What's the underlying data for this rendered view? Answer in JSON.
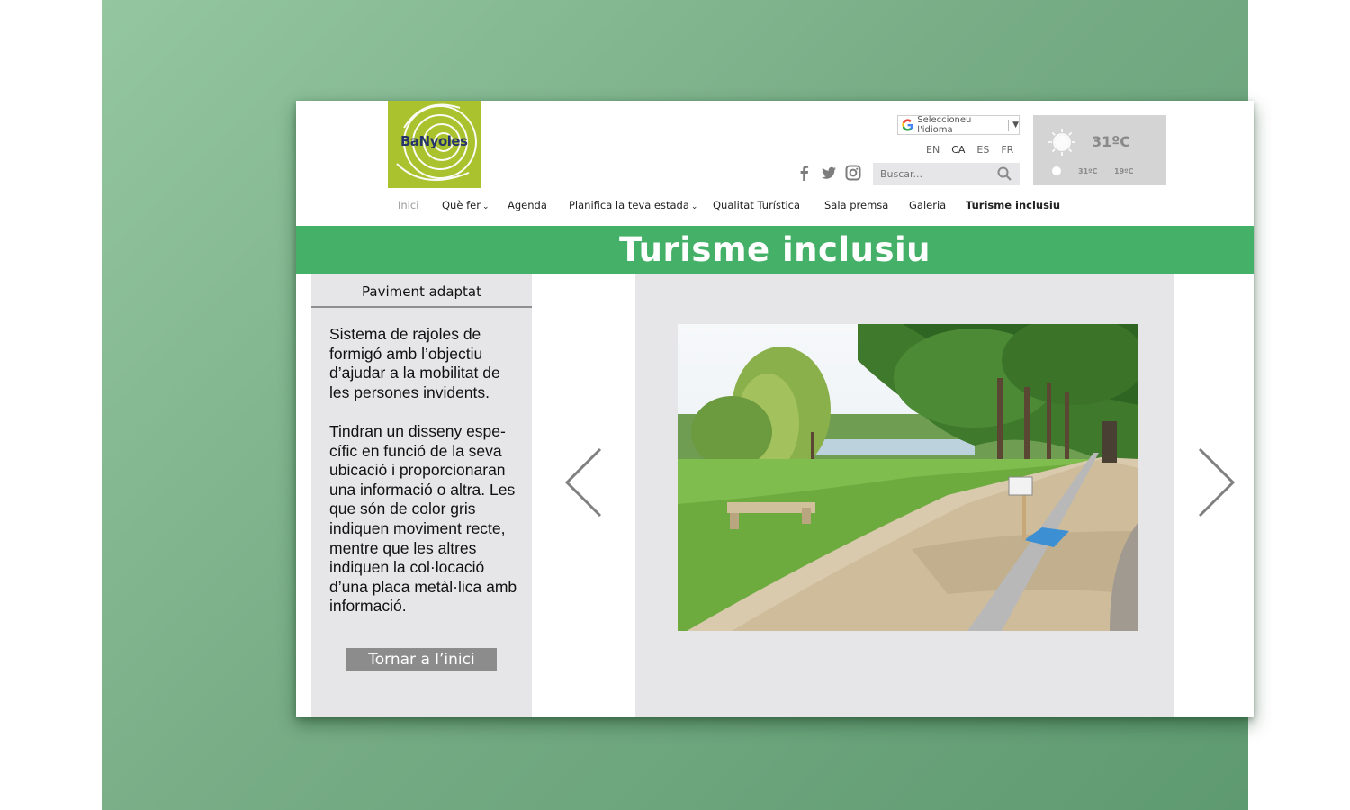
{
  "logo": {
    "text": "BaNyoles",
    "colors": {
      "background": "#a9c22d",
      "text": "#26346b"
    }
  },
  "language_select": {
    "label": "Seleccioneu l'idioma",
    "icon": "google-g-icon"
  },
  "languages": [
    "EN",
    "CA",
    "ES",
    "FR"
  ],
  "social": [
    "facebook-icon",
    "twitter-icon",
    "instagram-icon"
  ],
  "search": {
    "placeholder": "Buscar..."
  },
  "weather": {
    "current": "31ºC",
    "high": "31ºC",
    "low": "19ºC",
    "icon": "sun-icon"
  },
  "nav": {
    "items": [
      {
        "label": "Inici"
      },
      {
        "label": "Què fer"
      },
      {
        "label": "Agenda"
      },
      {
        "label": "Planifica la teva estada"
      },
      {
        "label": "Qualitat Turística"
      },
      {
        "label": "Sala premsa"
      },
      {
        "label": "Galeria"
      },
      {
        "label": "Turisme inclusiu"
      }
    ]
  },
  "banner": {
    "title": "Turisme inclusiu",
    "color": "#45b068"
  },
  "panel": {
    "title": "Paviment adaptat",
    "paragraph1": "Sistema de rajoles de formigó amb l’objectiu d’ajudar a la mobilitat de les persones invidents.",
    "paragraph2": "Tindran un disseny espe­cífic en funció de la seva ubicació i proporcionaran una informació o altra. Les que són de color gris indiquen moviment recte, mentre que les altres indiquen la col·locació d’una placa metàl·lica amb informació.",
    "back_button": "Tornar a l’inici"
  },
  "gallery": {
    "prev_icon": "chevron-left-icon",
    "next_icon": "chevron-right-icon"
  }
}
